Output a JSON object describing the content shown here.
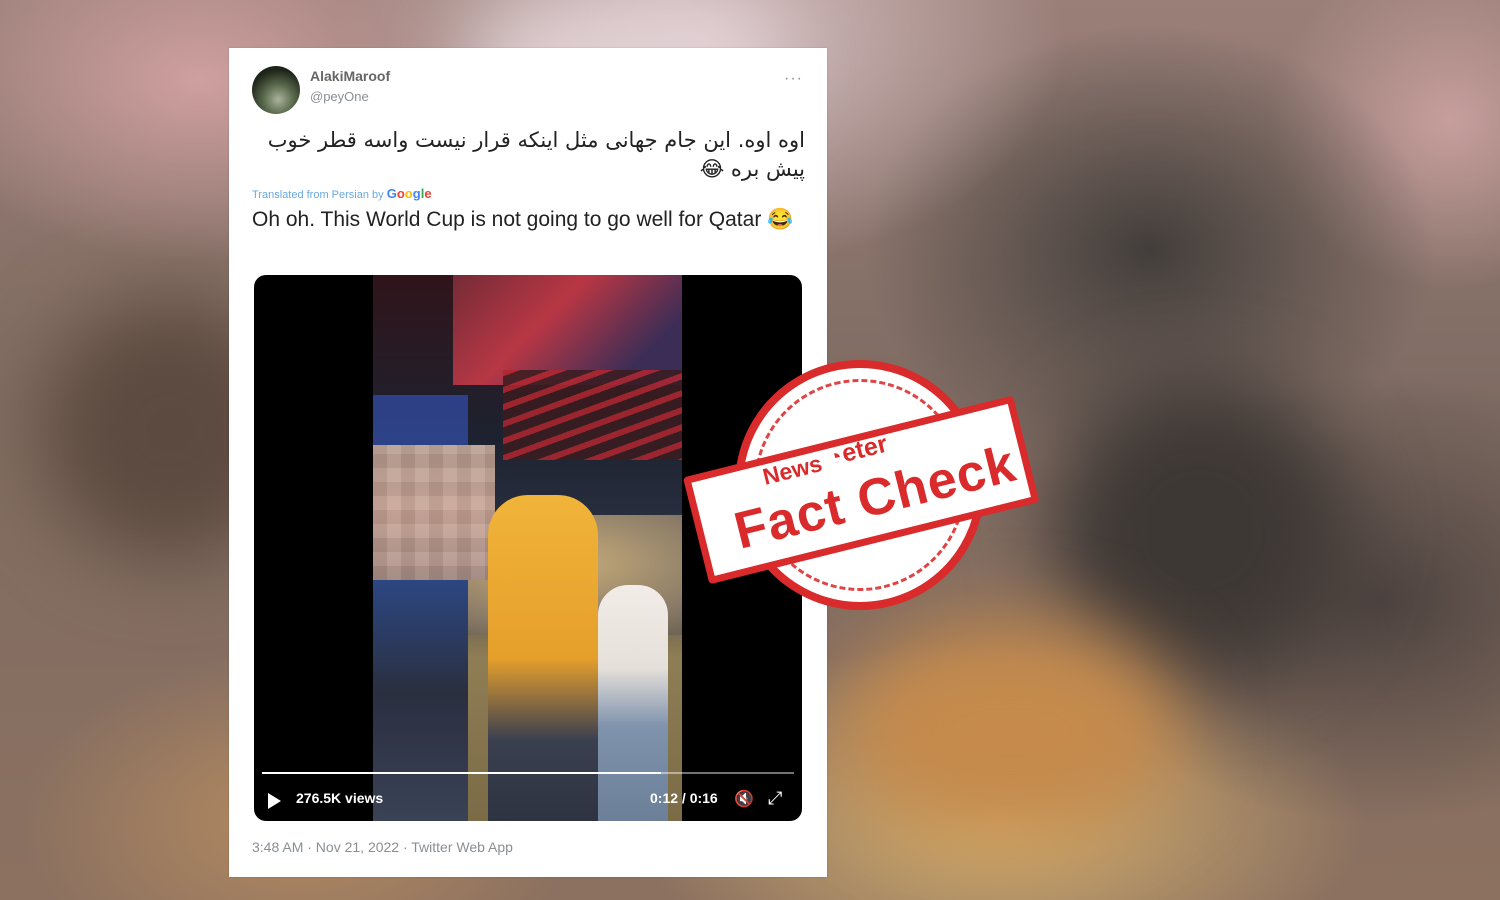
{
  "tweet": {
    "display_name": "AlakiMaroof",
    "handle": "@peyOne",
    "more": "···",
    "persian_text": "اوه اوه. این جام جهانی مثل اینکه قرار نیست واسه قطر خوب پیش بره 😂",
    "translated_label": "Translated from Persian by",
    "translated_by": "Google",
    "english_text": "Oh oh. This World Cup is not going to go well for Qatar 😂",
    "video": {
      "views": "276.5K views",
      "time": "0:12 / 0:16",
      "progress": 0.75
    },
    "meta": "3:48 AM · Nov 21, 2022 · Twitter Web App"
  },
  "stamp": {
    "news": "News",
    "meter": "eter",
    "label": "Fact Check",
    "color": "#d92b2b"
  }
}
